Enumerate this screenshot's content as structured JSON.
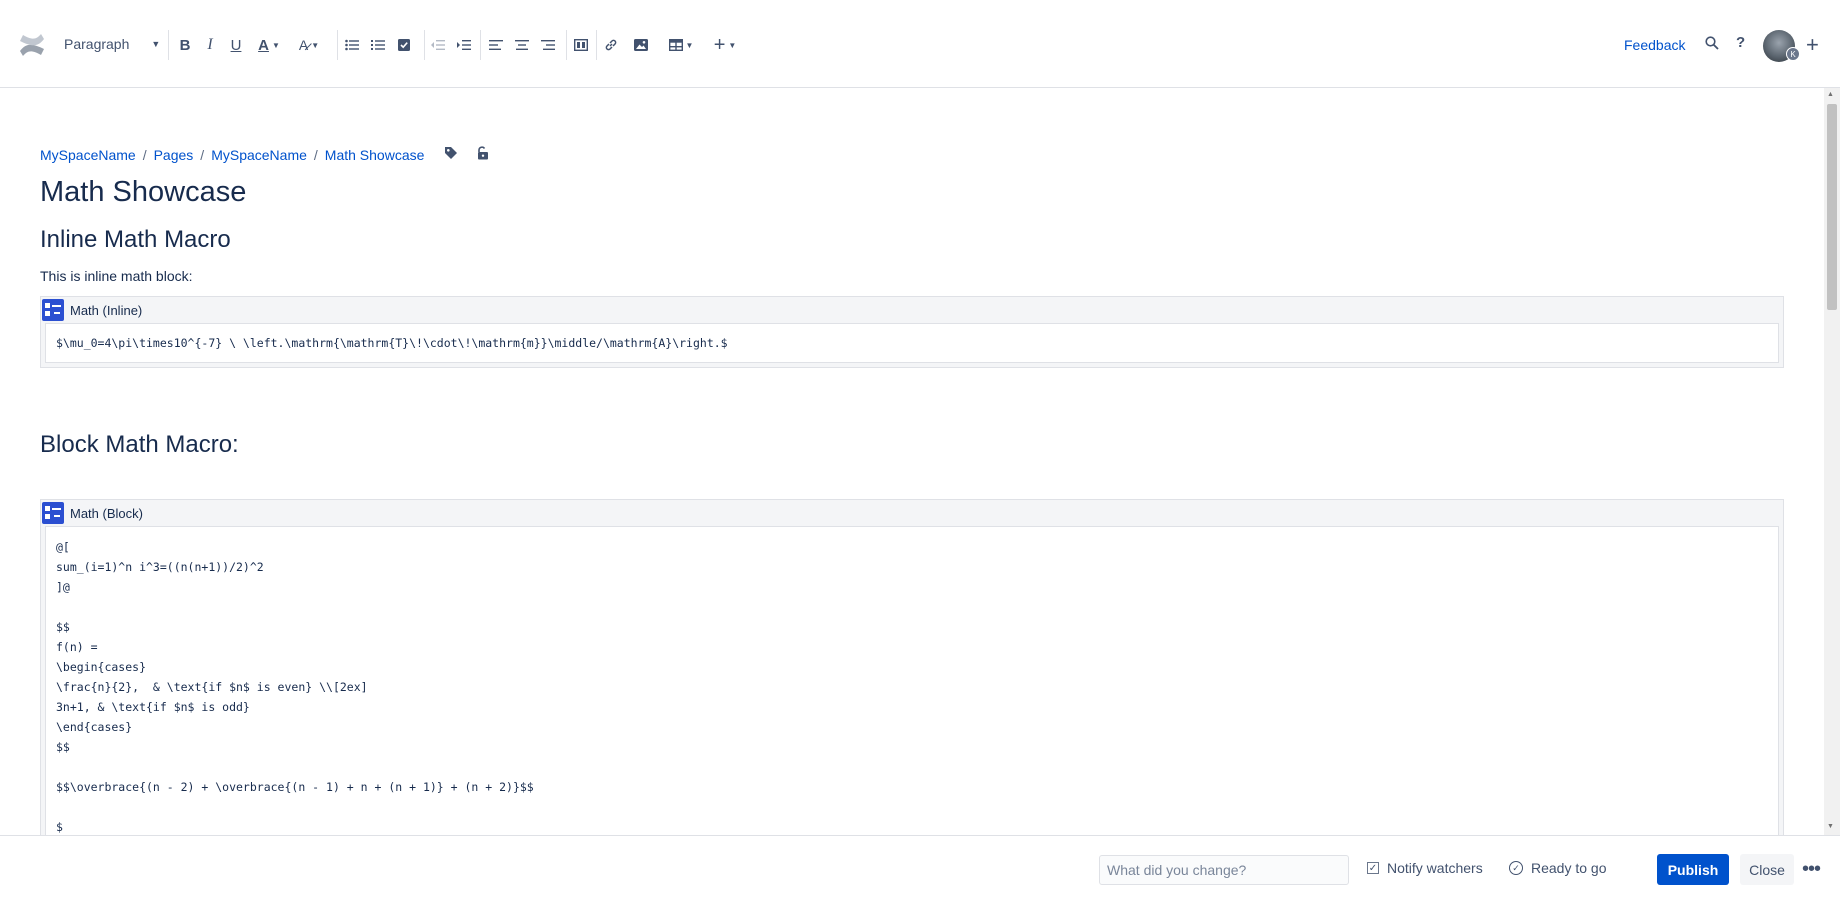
{
  "toolbar": {
    "style_select": "Paragraph",
    "buttons": [
      {
        "name": "bold-button",
        "icon": "bold-icon"
      },
      {
        "name": "italic-button",
        "icon": "italic-icon"
      },
      {
        "name": "underline-button",
        "icon": "underline-icon"
      },
      {
        "name": "text-color-button",
        "icon": "text-color-icon"
      },
      {
        "name": "text-format-button",
        "icon": "text-format-icon"
      },
      {
        "name": "bullet-list-button",
        "icon": "bullet-list-icon"
      },
      {
        "name": "numbered-list-button",
        "icon": "numbered-list-icon"
      },
      {
        "name": "task-list-button",
        "icon": "checkbox-icon"
      },
      {
        "name": "outdent-button",
        "icon": "outdent-icon"
      },
      {
        "name": "indent-button",
        "icon": "indent-icon"
      },
      {
        "name": "align-left-button",
        "icon": "align-left-icon"
      },
      {
        "name": "align-center-button",
        "icon": "align-center-icon"
      },
      {
        "name": "align-right-button",
        "icon": "align-right-icon"
      },
      {
        "name": "layout-button",
        "icon": "layout-icon"
      },
      {
        "name": "link-button",
        "icon": "link-icon"
      },
      {
        "name": "image-button",
        "icon": "image-icon"
      },
      {
        "name": "table-button",
        "icon": "table-icon"
      },
      {
        "name": "insert-more-button",
        "icon": "plus-icon"
      }
    ],
    "feedback": "Feedback",
    "avatar_badge": "K"
  },
  "breadcrumb": [
    "MySpaceName",
    "Pages",
    "MySpaceName",
    "Math Showcase"
  ],
  "page": {
    "title": "Math Showcase",
    "heading_inline": "Inline Math Macro",
    "paragraph": "This is inline math block:",
    "heading_block": "Block Math Macro:"
  },
  "macros": {
    "inline": {
      "label": "Math (Inline)",
      "body": "$\\mu_0=4\\pi\\times10^{-7} \\ \\left.\\mathrm{\\mathrm{T}\\!\\cdot\\!\\mathrm{m}}\\middle/\\mathrm{A}\\right.$"
    },
    "block": {
      "label": "Math (Block)",
      "body": "@[\nsum_(i=1)^n i^3=((n(n+1))/2)^2\n]@\n\n$$\nf(n) =\n\\begin{cases}\n\\frac{n}{2},  & \\text{if $n$ is even} \\\\[2ex]\n3n+1, & \\text{if $n$ is odd}\n\\end{cases}\n$$\n\n$$\\overbrace{(n - 2) + \\overbrace{(n - 1) + n + (n + 1)} + (n + 2)}$$\n\n$"
    }
  },
  "footer": {
    "change_placeholder": "What did you change?",
    "notify": "Notify watchers",
    "ready": "Ready to go",
    "publish": "Publish",
    "close": "Close"
  }
}
